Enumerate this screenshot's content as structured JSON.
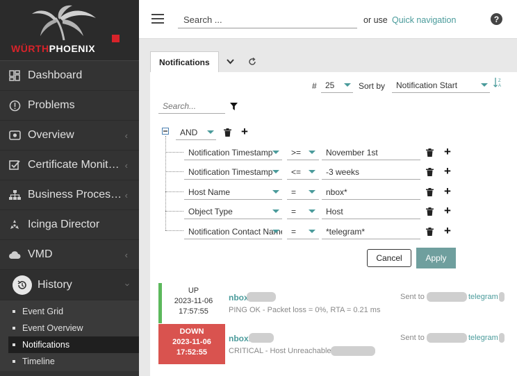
{
  "brand": {
    "name_red": "WÜRTH",
    "name_white": "PHOENIX",
    "accent": "#d8232a"
  },
  "sidebar": {
    "items": [
      {
        "label": "Dashboard",
        "icon": "dashboard-icon",
        "chevron": false
      },
      {
        "label": "Problems",
        "icon": "alert-circle-icon",
        "chevron": false
      },
      {
        "label": "Overview",
        "icon": "eye-icon",
        "chevron": true
      },
      {
        "label": "Certificate Monito…",
        "icon": "checkbox-icon",
        "chevron": true
      },
      {
        "label": "Business Process…",
        "icon": "sitemap-icon",
        "chevron": true
      },
      {
        "label": "Icinga Director",
        "icon": "director-icon",
        "chevron": false
      },
      {
        "label": "VMD",
        "icon": "cloud-icon",
        "chevron": true
      }
    ],
    "history": {
      "label": "History",
      "icon": "history-icon"
    },
    "subitems": [
      {
        "label": "Event Grid",
        "active": false
      },
      {
        "label": "Event Overview",
        "active": false
      },
      {
        "label": "Notifications",
        "active": true
      },
      {
        "label": "Timeline",
        "active": false
      }
    ]
  },
  "header": {
    "search_placeholder": "Search ...",
    "or_use": "or use",
    "quick_nav": "Quick navigation",
    "help": "?"
  },
  "tabs": {
    "active": "Notifications"
  },
  "controls": {
    "hash": "#",
    "limit": "25",
    "sort_by_label": "Sort by",
    "sort_by_value": "Notification Start",
    "search_placeholder": "Search..."
  },
  "filter": {
    "operator": "AND",
    "rules": [
      {
        "column": "Notification Timestamp",
        "sign": ">=",
        "value": "November 1st"
      },
      {
        "column": "Notification Timestamp",
        "sign": "<=",
        "value": "-3 weeks"
      },
      {
        "column": "Host Name",
        "sign": "=",
        "value": "nbox*"
      },
      {
        "column": "Object Type",
        "sign": "=",
        "value": "Host"
      },
      {
        "column": "Notification Contact Name",
        "sign": "=",
        "value": "*telegram*"
      }
    ],
    "cancel": "Cancel",
    "apply": "Apply"
  },
  "events": [
    {
      "state": "UP",
      "date": "2023-11-06",
      "time": "17:57:55",
      "host": "nbox",
      "output": "PING OK - Packet loss = 0%, RTA = 0.21 ms",
      "sent_to": "Sent to",
      "channel": "telegram",
      "color": "#5cb85c"
    },
    {
      "state": "DOWN",
      "date": "2023-11-06",
      "time": "17:52:55",
      "host": "nbox.",
      "output": "CRITICAL - Host Unreachable",
      "sent_to": "Sent to",
      "channel": "telegram",
      "color": "#d9534f"
    }
  ]
}
